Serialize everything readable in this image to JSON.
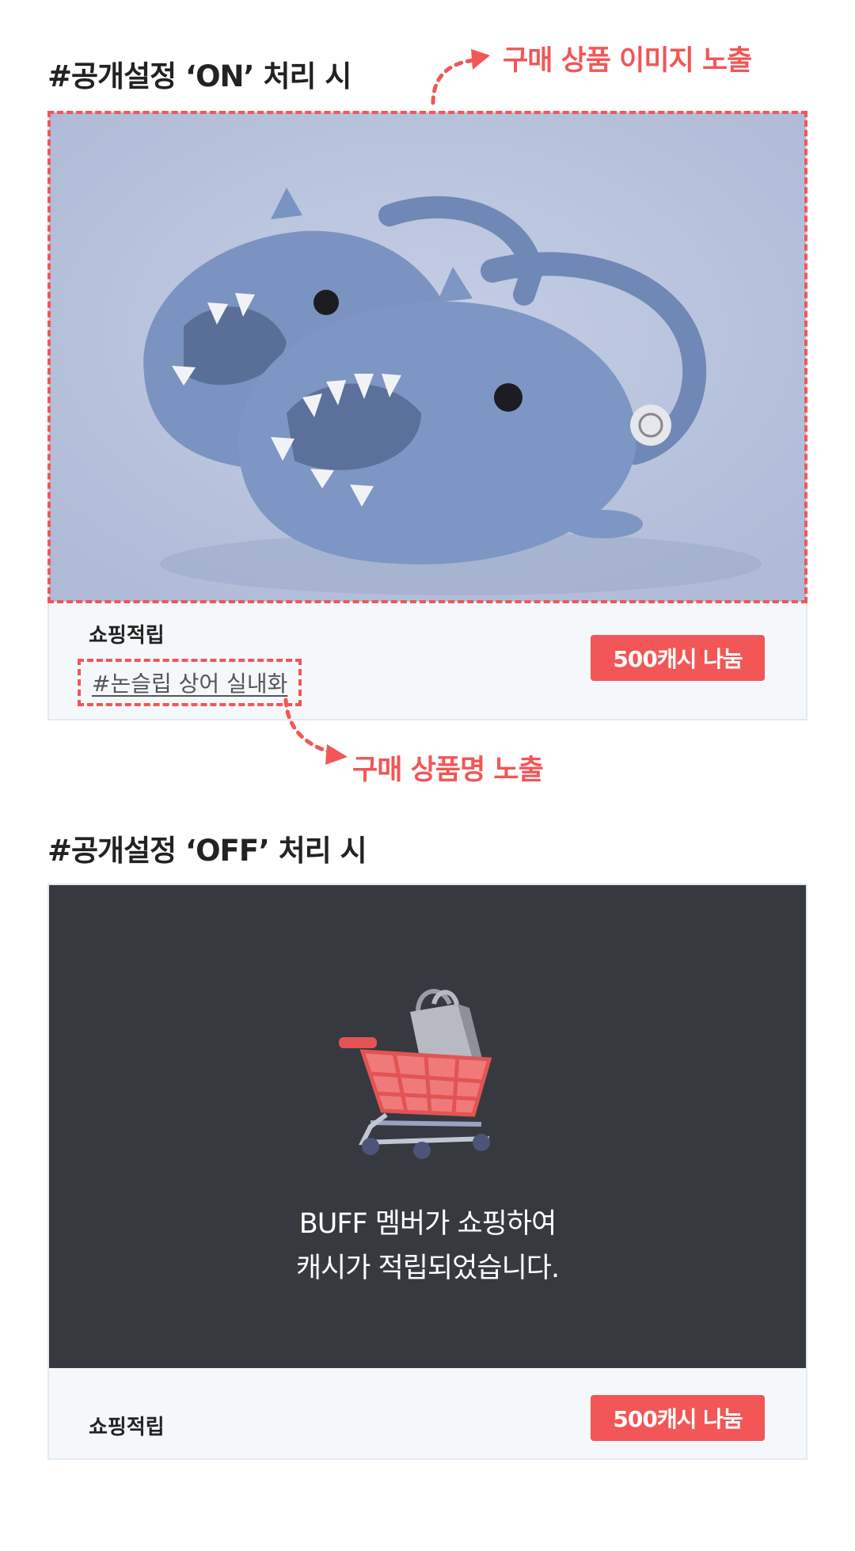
{
  "on_section": {
    "title": "#공개설정 ‘ON’ 처리 시",
    "image_annotation": "구매 상품 이미지 노출",
    "name_annotation": "구매 상품명 노출",
    "card": {
      "category": "쇼핑적립",
      "product_name": "#논슬립 상어 실내화",
      "cash_button": "500캐시 나눔"
    }
  },
  "off_section": {
    "title": "#공개설정 ‘OFF’ 처리 시",
    "card": {
      "notice_line1": "BUFF 멤버가 쇼핑하여",
      "notice_line2": "캐시가 적립되었습니다.",
      "category": "쇼핑적립",
      "cash_button": "500캐시 나눔"
    }
  },
  "colors": {
    "accent": "#f25656",
    "card_bg": "#f5f8fb",
    "dark_panel": "#363940",
    "photo_bg": "#b9c4de",
    "slipper": "#7a93c0"
  },
  "icons": [
    "arrow-curve-icon",
    "shopping-cart-icon",
    "shopping-bag-icon"
  ]
}
